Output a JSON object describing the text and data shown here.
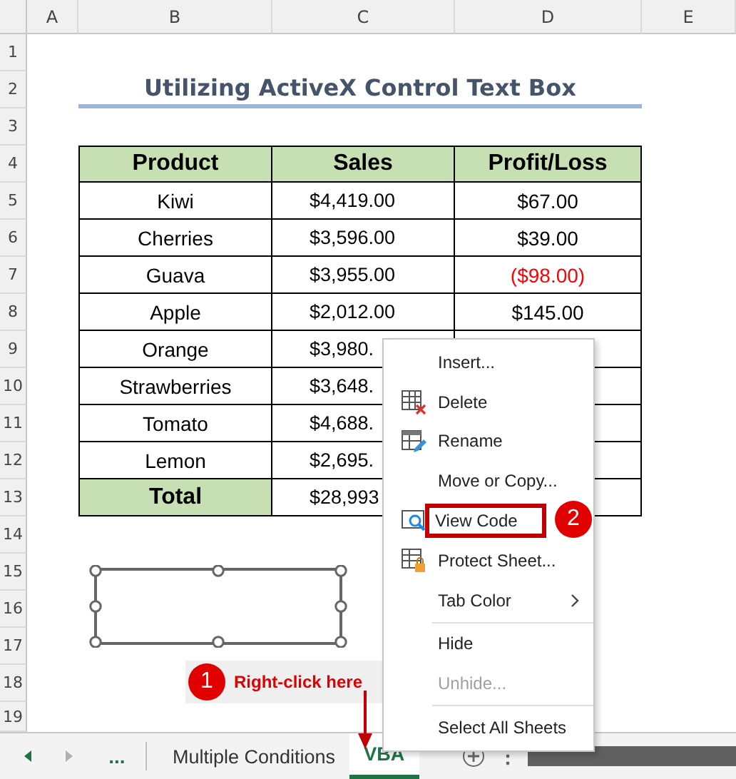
{
  "columns": [
    "A",
    "B",
    "C",
    "D",
    "E"
  ],
  "row_numbers": [
    "1",
    "2",
    "3",
    "4",
    "5",
    "6",
    "7",
    "8",
    "9",
    "10",
    "11",
    "12",
    "13",
    "14",
    "15",
    "16",
    "17",
    "18",
    "19"
  ],
  "title": "Utilizing ActiveX Control Text Box",
  "table": {
    "columns": [
      "Product",
      "Sales",
      "Profit/Loss"
    ],
    "rows": [
      {
        "product": "Kiwi",
        "sales": "$4,419.00",
        "profit": "$67.00",
        "negative": false
      },
      {
        "product": "Cherries",
        "sales": "$3,596.00",
        "profit": "$39.00",
        "negative": false
      },
      {
        "product": "Guava",
        "sales": "$3,955.00",
        "profit": "($98.00)",
        "negative": true
      },
      {
        "product": "Apple",
        "sales": "$2,012.00",
        "profit": "$145.00",
        "negative": false
      },
      {
        "product": "Orange",
        "sales": "$3,980."
      },
      {
        "product": "Strawberries",
        "sales": "$3,648."
      },
      {
        "product": "Tomato",
        "sales": "$4,688."
      },
      {
        "product": "Lemon",
        "sales": "$2,695."
      }
    ],
    "total": {
      "label": "Total",
      "sales": "$28,993"
    }
  },
  "callout": {
    "badge": "1",
    "text": "Right-click here"
  },
  "sheet_tabs": {
    "more": "...",
    "tabs": [
      {
        "label": "Multiple Conditions",
        "selected": false
      },
      {
        "label": "VBA",
        "selected": true
      }
    ]
  },
  "context_menu": {
    "badge": "2",
    "items": [
      {
        "label": "Insert...",
        "kind": "plain",
        "disabled": false,
        "submenu": false,
        "highlighted": false,
        "separator_before": false
      },
      {
        "label": "Delete",
        "kind": "delete",
        "disabled": false,
        "submenu": false,
        "highlighted": false,
        "separator_before": false
      },
      {
        "label": "Rename",
        "kind": "rename",
        "disabled": false,
        "submenu": false,
        "highlighted": false,
        "separator_before": false
      },
      {
        "label": "Move or Copy...",
        "kind": "plain",
        "disabled": false,
        "submenu": false,
        "highlighted": false,
        "separator_before": false
      },
      {
        "label": "View Code",
        "kind": "code",
        "disabled": false,
        "submenu": false,
        "highlighted": true,
        "separator_before": false
      },
      {
        "label": "Protect Sheet...",
        "kind": "protect",
        "disabled": false,
        "submenu": false,
        "highlighted": false,
        "separator_before": false
      },
      {
        "label": "Tab Color",
        "kind": "plain",
        "disabled": false,
        "submenu": true,
        "highlighted": false,
        "separator_before": false
      },
      {
        "label": "Hide",
        "kind": "plain",
        "disabled": false,
        "submenu": false,
        "highlighted": false,
        "separator_before": true
      },
      {
        "label": "Unhide...",
        "kind": "plain",
        "disabled": true,
        "submenu": false,
        "highlighted": false,
        "separator_before": false
      },
      {
        "label": "Select All Sheets",
        "kind": "plain",
        "disabled": false,
        "submenu": false,
        "highlighted": false,
        "separator_before": true
      }
    ]
  }
}
